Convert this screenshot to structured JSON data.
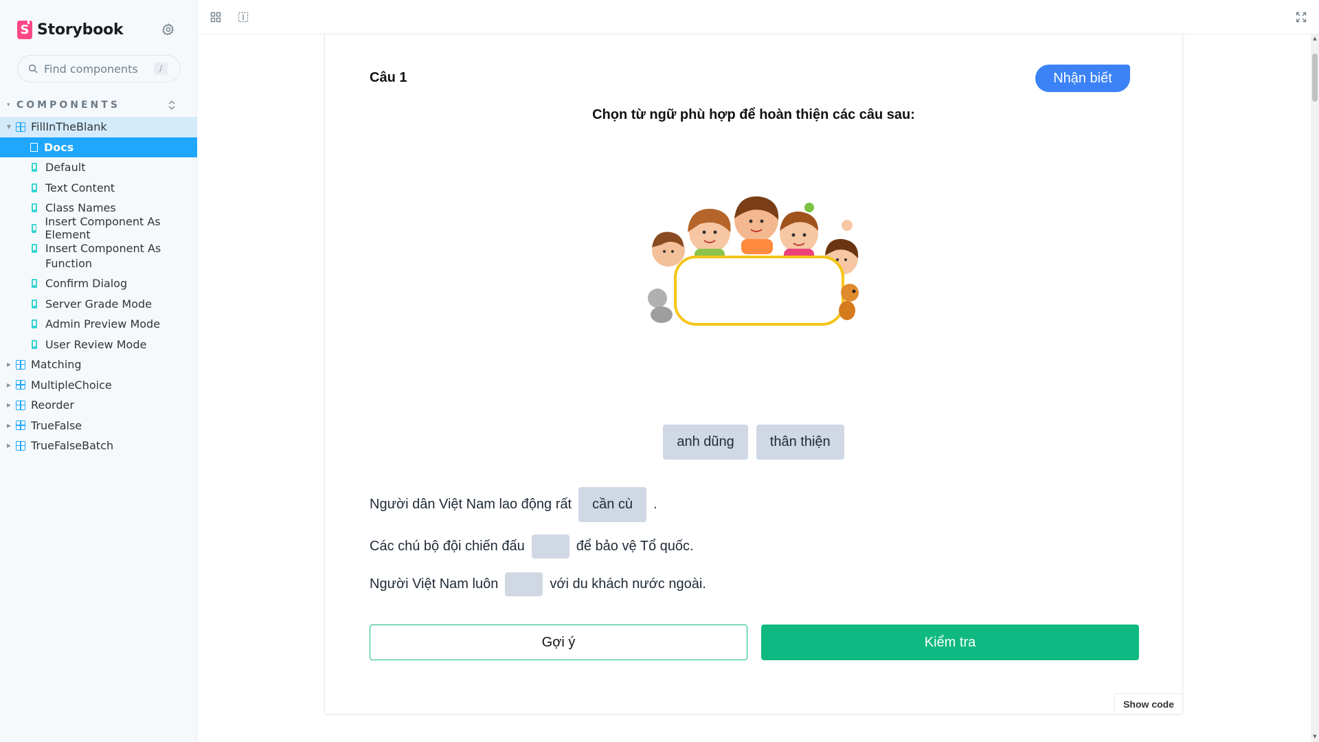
{
  "brand": {
    "name": "Storybook"
  },
  "search": {
    "placeholder": "Find components",
    "shortcut": "/"
  },
  "sidebar": {
    "section_title": "COMPONENTS",
    "tree": [
      {
        "label": "FillInTheBlank",
        "expanded": true,
        "children": [
          {
            "label": "Docs",
            "type": "docs",
            "active": true
          },
          {
            "label": "Default",
            "type": "story"
          },
          {
            "label": "Text Content",
            "type": "story"
          },
          {
            "label": "Class Names",
            "type": "story"
          },
          {
            "label": "Insert Component As Element",
            "type": "story"
          },
          {
            "label": "Insert Component As Function",
            "type": "story"
          },
          {
            "label": "Confirm Dialog",
            "type": "story"
          },
          {
            "label": "Server Grade Mode",
            "type": "story"
          },
          {
            "label": "Admin Preview Mode",
            "type": "story"
          },
          {
            "label": "User Review Mode",
            "type": "story"
          }
        ]
      },
      {
        "label": "Matching",
        "expanded": false
      },
      {
        "label": "MultipleChoice",
        "expanded": false
      },
      {
        "label": "Reorder",
        "expanded": false
      },
      {
        "label": "TrueFalse",
        "expanded": false
      },
      {
        "label": "TrueFalseBatch",
        "expanded": false
      }
    ]
  },
  "question": {
    "title": "Câu 1",
    "level": "Nhận biết",
    "instruction": "Chọn từ ngữ phù hợp để hoàn thiện các câu sau:",
    "word_bank": [
      "anh dũng",
      "thân thiện"
    ],
    "sentences": [
      {
        "before": "Người dân Việt Nam lao động rất",
        "answer": "cần cù",
        "after": "."
      },
      {
        "before": "Các chú bộ đội chiến đấu",
        "answer": "",
        "after": "để bảo vệ Tổ quốc."
      },
      {
        "before": "Người Việt Nam luôn",
        "answer": "",
        "after": "với du khách nước ngoài."
      }
    ],
    "hint_label": "Gợi ý",
    "check_label": "Kiểm tra"
  },
  "show_code_label": "Show code",
  "colors": {
    "accent": "#1ea7fd",
    "brand": "#ff4785",
    "badge": "#3b82f6",
    "success": "#10b981",
    "chip": "#cfd8e3"
  }
}
